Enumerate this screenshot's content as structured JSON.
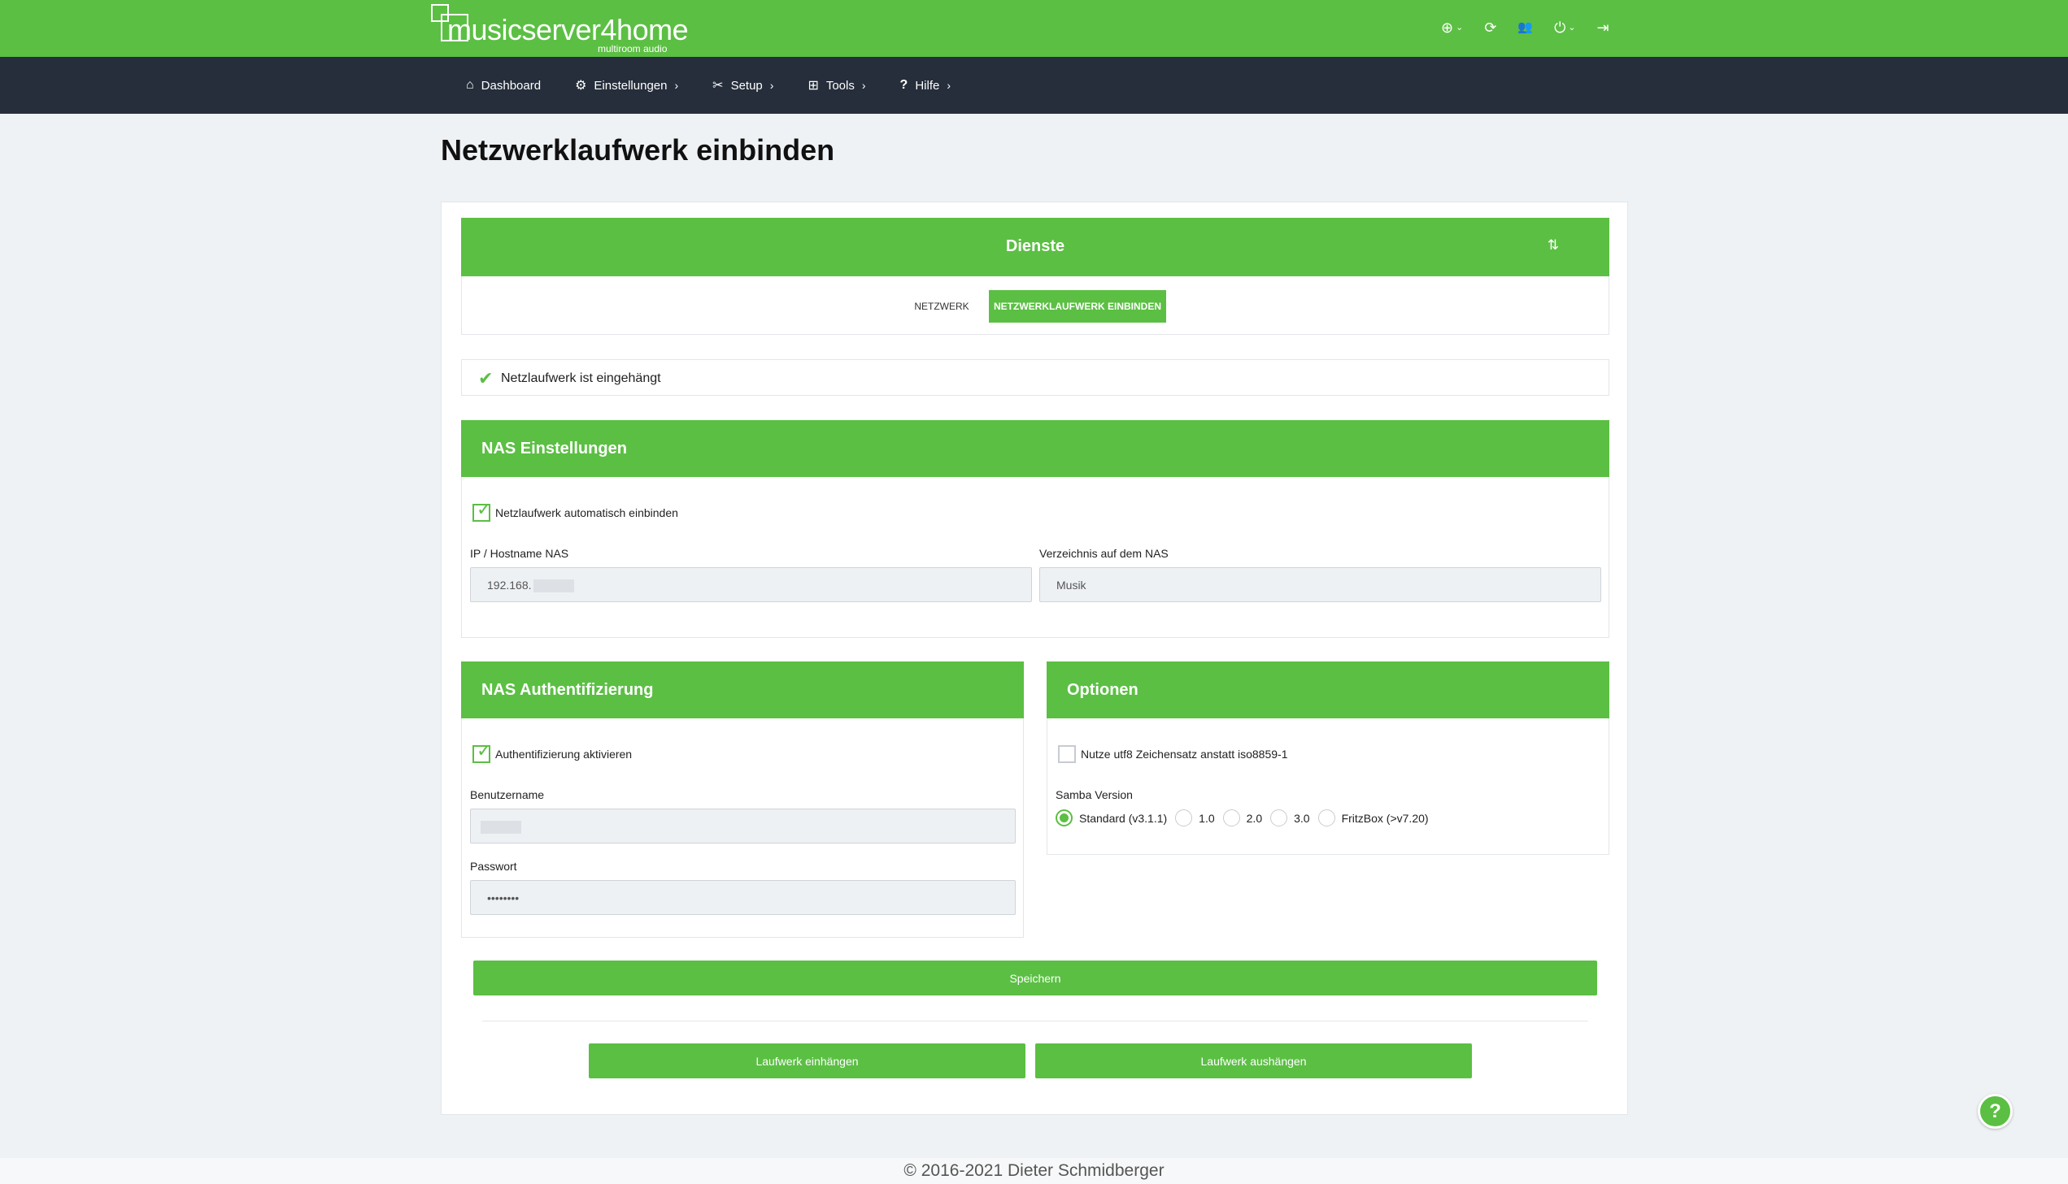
{
  "brand": {
    "name": "musicserver4home",
    "tagline": "multiroom audio",
    "accent_color": "#5bbf43",
    "nav_color": "#262e3b"
  },
  "top_icons": [
    {
      "icon": "globe-icon",
      "glyph": "⊕",
      "has_chevron": true
    },
    {
      "icon": "refresh-icon",
      "glyph": "⟳",
      "has_chevron": false
    },
    {
      "icon": "users-icon",
      "glyph": "👥",
      "has_chevron": false
    },
    {
      "icon": "power-icon",
      "glyph": "⏻",
      "has_chevron": true
    },
    {
      "icon": "logout-icon",
      "glyph": "⇥",
      "has_chevron": false
    }
  ],
  "nav": {
    "dashboard": "Dashboard",
    "einstellungen": "Einstellungen",
    "setup": "Setup",
    "tools": "Tools",
    "hilfe": "Hilfe"
  },
  "page": {
    "title": "Netzwerklaufwerk einbinden"
  },
  "dienste": {
    "title": "Dienste",
    "tabs": [
      {
        "label": "NETZWERK",
        "active": false
      },
      {
        "label": "NETZWERKLAUFWERK EINBINDEN",
        "active": true
      }
    ]
  },
  "status": {
    "message": "Netzlaufwerk ist eingehängt"
  },
  "nas": {
    "title": "NAS Einstellungen",
    "auto_mount_label": "Netzlaufwerk automatisch einbinden",
    "auto_mount_checked": true,
    "host_label": "IP / Hostname NAS",
    "host_value": "192.168.",
    "dir_label": "Verzeichnis auf dem NAS",
    "dir_value": "Musik"
  },
  "auth": {
    "title": "NAS Authentifizierung",
    "enable_label": "Authentifizierung aktivieren",
    "enable_checked": true,
    "username_label": "Benutzername",
    "password_label": "Passwort",
    "password_value": "••••••••"
  },
  "options": {
    "title": "Optionen",
    "utf8_label": "Nutze utf8 Zeichensatz anstatt iso8859-1",
    "utf8_checked": false,
    "samba_label": "Samba Version",
    "samba_options": [
      "Standard (v3.1.1)",
      "1.0",
      "2.0",
      "3.0",
      "FritzBox (>v7.20)"
    ],
    "samba_selected": "Standard (v3.1.1)"
  },
  "buttons": {
    "save": "Speichern",
    "mount": "Laufwerk einhängen",
    "unmount": "Laufwerk aushängen"
  },
  "help": "?",
  "footer": "© 2016-2021 Dieter Schmidberger"
}
